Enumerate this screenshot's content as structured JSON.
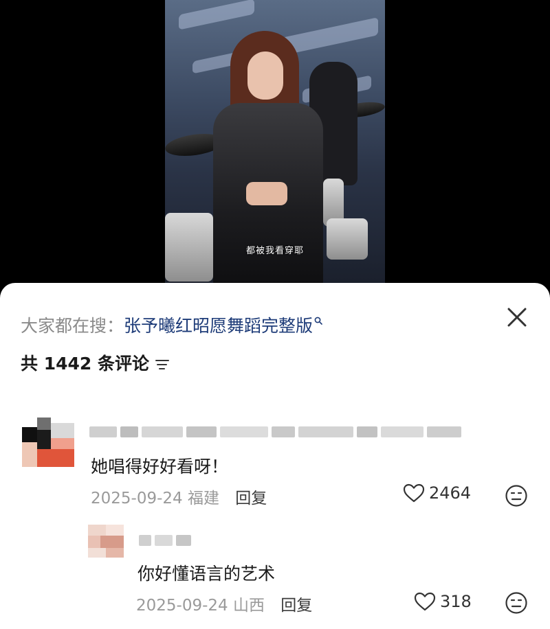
{
  "video": {
    "caption": "都被我看穿耶"
  },
  "sheet": {
    "search": {
      "prefix": "大家都在搜：",
      "term": "张予曦红昭愿舞蹈完整版",
      "term_icon": "search-icon"
    },
    "close_icon": "close-icon",
    "comment_count_label": "共 1442 条评论",
    "filter_icon": "filter-icon",
    "comments": [
      {
        "username": "",
        "text": "她唱得好好看呀！",
        "date": "2025-09-24",
        "location": "福建",
        "reply_label": "回复",
        "likes": "2464"
      }
    ],
    "replies": [
      {
        "username": "",
        "text": "你好懂语言的艺术",
        "date": "2025-09-24",
        "location": "山西",
        "reply_label": "回复",
        "likes": "318"
      }
    ]
  },
  "colors": {
    "search_term": "#1d3b78",
    "meta_gray": "#9a9a9a"
  }
}
